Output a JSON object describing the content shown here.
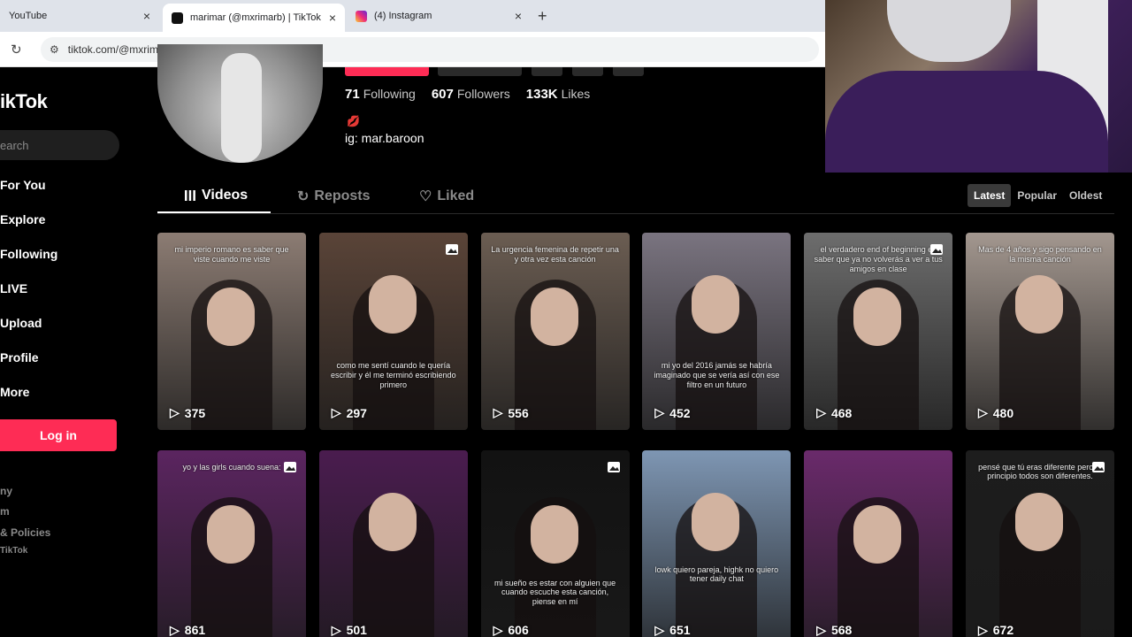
{
  "browser": {
    "tabs": [
      {
        "title": "YouTube"
      },
      {
        "title": "marimar (@mxrimarb) | TikTok"
      },
      {
        "title": "(4) Instagram"
      }
    ],
    "new_tab": "+",
    "close_glyph": "×",
    "url": "tiktok.com/@mxrimarb"
  },
  "sidebar": {
    "logo": "ikTok",
    "search_placeholder": "earch",
    "nav": [
      {
        "label": "For You"
      },
      {
        "label": "Explore"
      },
      {
        "label": "Following"
      },
      {
        "label": "LIVE"
      },
      {
        "label": "Upload"
      },
      {
        "label": "Profile"
      },
      {
        "label": "More"
      }
    ],
    "login_label": "Log in",
    "footer": [
      "ny",
      "m",
      "& Policies",
      "TikTok"
    ]
  },
  "profile": {
    "stats": [
      {
        "value": "71",
        "label": "Following"
      },
      {
        "value": "607",
        "label": "Followers"
      },
      {
        "value": "133K",
        "label": "Likes"
      }
    ],
    "bio_emoji": "💋",
    "bio": "ig: mar.baroon"
  },
  "tabs": [
    {
      "label": "Videos",
      "icon": "grid-icon"
    },
    {
      "label": "Reposts",
      "icon": "repost-icon"
    },
    {
      "label": "Liked",
      "icon": "heart-icon"
    }
  ],
  "sort": [
    "Latest",
    "Popular",
    "Oldest"
  ],
  "videos": [
    {
      "views": "375",
      "caption": "mi imperio romano es saber que viste cuando me viste",
      "bg": "#8c7c73",
      "photo": false
    },
    {
      "views": "297",
      "caption": "como me sentí cuando le quería escribir y él me terminó escribiendo primero",
      "bg": "#5a4438",
      "photo": true
    },
    {
      "views": "556",
      "caption": "La urgencia femenina de repetir una y otra vez esta canción",
      "bg": "#6b5d52",
      "photo": false
    },
    {
      "views": "452",
      "caption": "mi yo del 2016 jamás se habría imaginado que se vería así con ese filtro en un futuro",
      "bg": "#7a7480",
      "photo": false
    },
    {
      "views": "468",
      "caption": "el verdadero end of beginning es saber que ya no volverás a ver a tus amigos en clase",
      "bg": "#6d6d6d",
      "photo": true
    },
    {
      "views": "480",
      "caption": "Mas de 4 años y sigo pensando en la misma canción",
      "bg": "#a3978f",
      "photo": false
    },
    {
      "views": "861",
      "caption": "yo y las girls cuando suena:",
      "bg": "#5b2560",
      "photo": true
    },
    {
      "views": "501",
      "caption": "",
      "bg": "#4a1c4f",
      "photo": false
    },
    {
      "views": "606",
      "caption": "mi sueño es estar con alguien que cuando escuche esta canción, piense en mí",
      "bg": "#121212",
      "photo": true
    },
    {
      "views": "651",
      "caption": "lowk quiero pareja, highk no quiero tener daily chat",
      "bg": "#7e96b3",
      "photo": false
    },
    {
      "views": "568",
      "caption": "",
      "bg": "#6a2a6b",
      "photo": false
    },
    {
      "views": "672",
      "caption": "pensé que tú eras diferente pero al principio todos son diferentes.",
      "bg": "#1d1d1d",
      "photo": true
    }
  ],
  "colors": {
    "accent": "#fe2c55",
    "background": "#000000"
  }
}
